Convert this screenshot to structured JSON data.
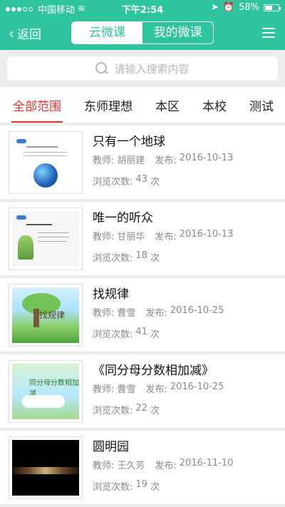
{
  "status_bar": {
    "carrier": "中国移动",
    "time": "下午2:54",
    "battery_percent": "58%",
    "battery_level": 0.58
  },
  "nav": {
    "back_label": "返回",
    "segments": [
      {
        "label": "云微课",
        "active": true
      },
      {
        "label": "我的微课",
        "active": false
      }
    ]
  },
  "search": {
    "placeholder": "请输入搜索内容"
  },
  "tabs": [
    {
      "label": "全部范围",
      "active": true
    },
    {
      "label": "东师理想",
      "active": false
    },
    {
      "label": "本区",
      "active": false
    },
    {
      "label": "本校",
      "active": false
    },
    {
      "label": "测试",
      "active": false
    }
  ],
  "labels": {
    "teacher_prefix": "教师:",
    "publish_prefix": "发布:",
    "views_prefix": "浏览次数:",
    "views_suffix": "次"
  },
  "items": [
    {
      "title": "只有一个地球",
      "teacher": "胡丽建",
      "date": "2016-10-13",
      "views": "43"
    },
    {
      "title": "唯一的听众",
      "teacher": "甘丽华",
      "date": "2016-10-13",
      "views": "18"
    },
    {
      "title": "找规律",
      "teacher": "曹雪",
      "date": "2016-10-25",
      "views": "41"
    },
    {
      "title": "《同分母分数相加减》",
      "teacher": "曹雪",
      "date": "2016-10-25",
      "views": "22"
    },
    {
      "title": "圆明园",
      "teacher": "王久芳",
      "date": "2016-11-10",
      "views": "19"
    }
  ],
  "thumb_text": {
    "item3_word": "找规律",
    "item4_word": "同分母分数相加减"
  },
  "colors": {
    "brand": "#2ec4a0",
    "active_tab": "#e8302a"
  }
}
